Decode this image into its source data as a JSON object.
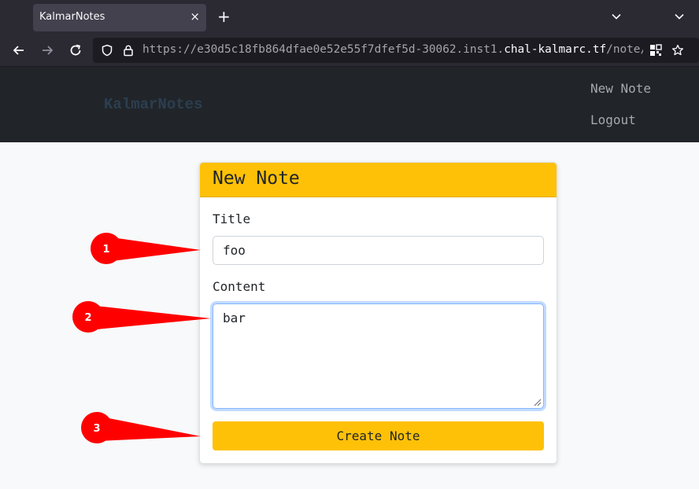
{
  "browser": {
    "tab_title": "KalmarNotes",
    "close_glyph": "×",
    "new_tab_glyph": "+",
    "url_prefix": "https://e30d5c18fb864dfae0e52e55f7dfef5d-30062.inst1.",
    "url_domain": "chal-kalmarc.tf",
    "url_suffix": "/note/",
    "icons": [
      "back-icon",
      "forward-icon",
      "reload-icon",
      "shield-icon",
      "lock-icon",
      "qr-code-icon",
      "bookmark-star-icon",
      "chevron-down-icon"
    ]
  },
  "header": {
    "brand": "KalmarNotes",
    "nav": {
      "new_note": "New Note",
      "logout": "Logout"
    }
  },
  "form": {
    "heading": "New Note",
    "title_label": "Title",
    "title_value": "foo",
    "content_label": "Content",
    "content_value": "bar",
    "submit_label": "Create Note"
  },
  "annotations": [
    "1",
    "2",
    "3"
  ],
  "colors": {
    "accent": "#ffc107",
    "header_bg": "#212529",
    "callout": "#ff0000",
    "focus_ring": "#86b7fe"
  }
}
